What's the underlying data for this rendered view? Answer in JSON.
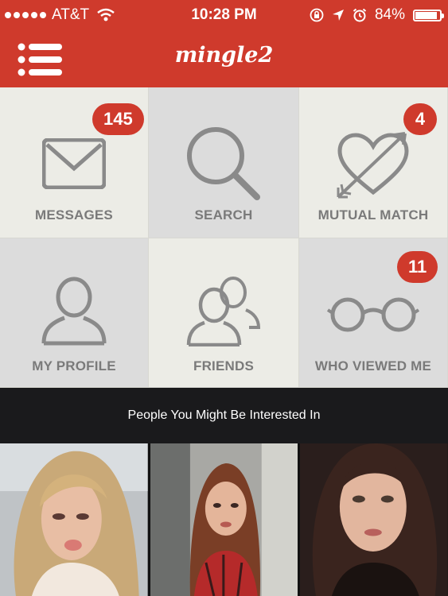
{
  "status_bar": {
    "carrier": "AT&T",
    "time": "10:28 PM",
    "battery": "84%",
    "battery_level": 0.84
  },
  "header": {
    "logo": "mingle2",
    "menu_icon": "list-menu-icon"
  },
  "tiles": [
    {
      "label": "MESSAGES",
      "badge": "145",
      "icon": "envelope-icon"
    },
    {
      "label": "SEARCH",
      "badge": "",
      "icon": "magnifier-icon"
    },
    {
      "label": "MUTUAL MATCH",
      "badge": "4",
      "icon": "heart-arrow-icon"
    },
    {
      "label": "MY PROFILE",
      "badge": "",
      "icon": "person-icon"
    },
    {
      "label": "FRIENDS",
      "badge": "",
      "icon": "people-icon"
    },
    {
      "label": "WHO VIEWED ME",
      "badge": "11",
      "icon": "glasses-icon"
    }
  ],
  "suggestions": {
    "title": "People You Might Be Interested In",
    "photos": [
      {
        "name": "profile-photo-1"
      },
      {
        "name": "profile-photo-2"
      },
      {
        "name": "profile-photo-3"
      }
    ]
  },
  "colors": {
    "brand_red": "#cf3a2c",
    "tile_light": "#ecece6",
    "tile_dark": "#dcdcdc",
    "icon_gray": "#8a8a8a",
    "dark_band": "#1a1a1c"
  }
}
